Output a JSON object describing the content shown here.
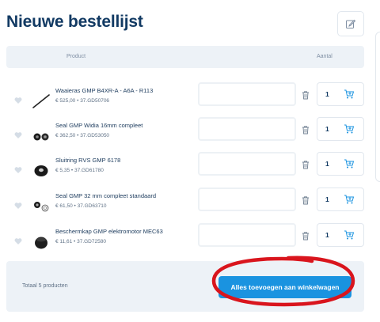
{
  "page": {
    "title": "Nieuwe bestellijst"
  },
  "table": {
    "col_product": "Product",
    "col_qty": "Aantal"
  },
  "items": [
    {
      "name": "Waaieras GMP B4XR-A - A6A - R113",
      "meta": "€ 525,00  •  37.GD50706",
      "qty": "1",
      "image": "shaft"
    },
    {
      "name": "Seal GMP Widia 16mm compleet",
      "meta": "€ 362,50  •  37.GD53050",
      "qty": "1",
      "image": "seal-pair"
    },
    {
      "name": "Sluitring RVS GMP 6178",
      "meta": "€ 5,35  •  37.GD61780",
      "qty": "1",
      "image": "washer"
    },
    {
      "name": "Seal GMP 32 mm compleet standaard",
      "meta": "€ 61,50  •  37.GD63710",
      "qty": "1",
      "image": "seal-set"
    },
    {
      "name": "Beschermkap GMP elektromotor MEC63",
      "meta": "€ 11,61  •  37.GD72580",
      "qty": "1",
      "image": "cap"
    }
  ],
  "footer": {
    "total": "Totaal 5 producten",
    "add_all_label": "Alles toevoegen aan winkelwagen"
  },
  "icons": {
    "edit": "edit-icon",
    "favorite": "heart-icon",
    "delete": "trash-icon",
    "cart": "cart-icon"
  },
  "colors": {
    "accent": "#1a93e0",
    "title": "#123a63",
    "highlight_circle": "#d9151d"
  }
}
